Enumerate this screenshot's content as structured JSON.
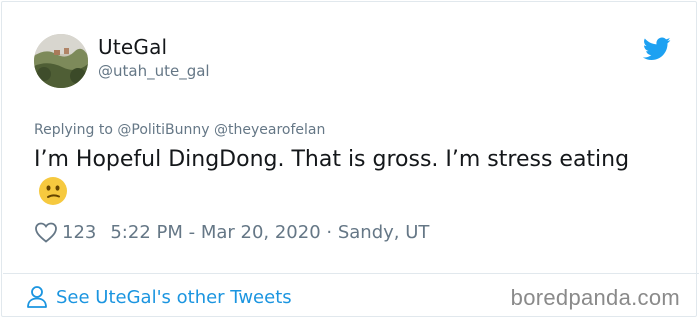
{
  "author": {
    "display_name": "UteGal",
    "handle": "@utah_ute_gal"
  },
  "reply": {
    "prefix": "Replying to",
    "mentions": [
      "@PolitiBunny",
      "@theyearofelan"
    ]
  },
  "tweet": {
    "text": "I’m Hopeful DingDong. That is gross. I’m stress eating",
    "emoji": "confused-face"
  },
  "meta": {
    "likes": "123",
    "timestamp": "5:22 PM - Mar 20, 2020 · Sandy, UT"
  },
  "footer": {
    "other_tweets_link": "See UteGal's other Tweets",
    "watermark": "boredpanda.com"
  },
  "colors": {
    "link_blue": "#1b95e0",
    "twitter_blue": "#1da1f2",
    "muted_gray": "#657786"
  }
}
